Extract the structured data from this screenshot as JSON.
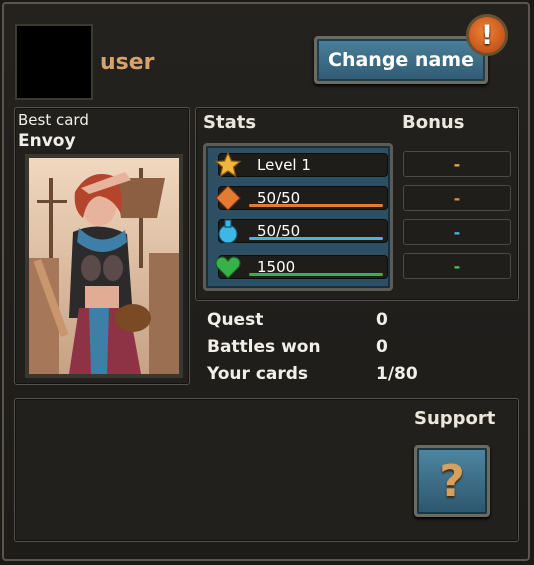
{
  "profile": {
    "username": "user",
    "change_name_label": "Change name",
    "alert_icon": "exclamation-icon"
  },
  "best_card": {
    "label": "Best card",
    "name": "Envoy"
  },
  "stats": {
    "title": "Stats",
    "bonus_title": "Bonus",
    "rows": [
      {
        "icon": "star-icon",
        "text": "Level 1",
        "color": "#f4b63a",
        "fill": 0
      },
      {
        "icon": "diamond-icon",
        "text": "50/50",
        "color": "#e47b35",
        "fill": 1
      },
      {
        "icon": "potion-icon",
        "text": "50/50",
        "color": "#3fb7e5",
        "fill": 1
      },
      {
        "icon": "heart-icon",
        "text": "1500",
        "color": "#37b24a",
        "fill": 1
      }
    ],
    "bonuses": [
      {
        "text": "-",
        "color": "#e9a84a"
      },
      {
        "text": "-",
        "color": "#e58a45"
      },
      {
        "text": "-",
        "color": "#3fb7e5"
      },
      {
        "text": "-",
        "color": "#47c259"
      }
    ]
  },
  "info": [
    {
      "label": "Quest",
      "value": "0"
    },
    {
      "label": "Battles won",
      "value": "0"
    },
    {
      "label": "Your cards",
      "value": "1/80"
    }
  ],
  "support": {
    "title": "Support",
    "button_glyph": "?"
  }
}
